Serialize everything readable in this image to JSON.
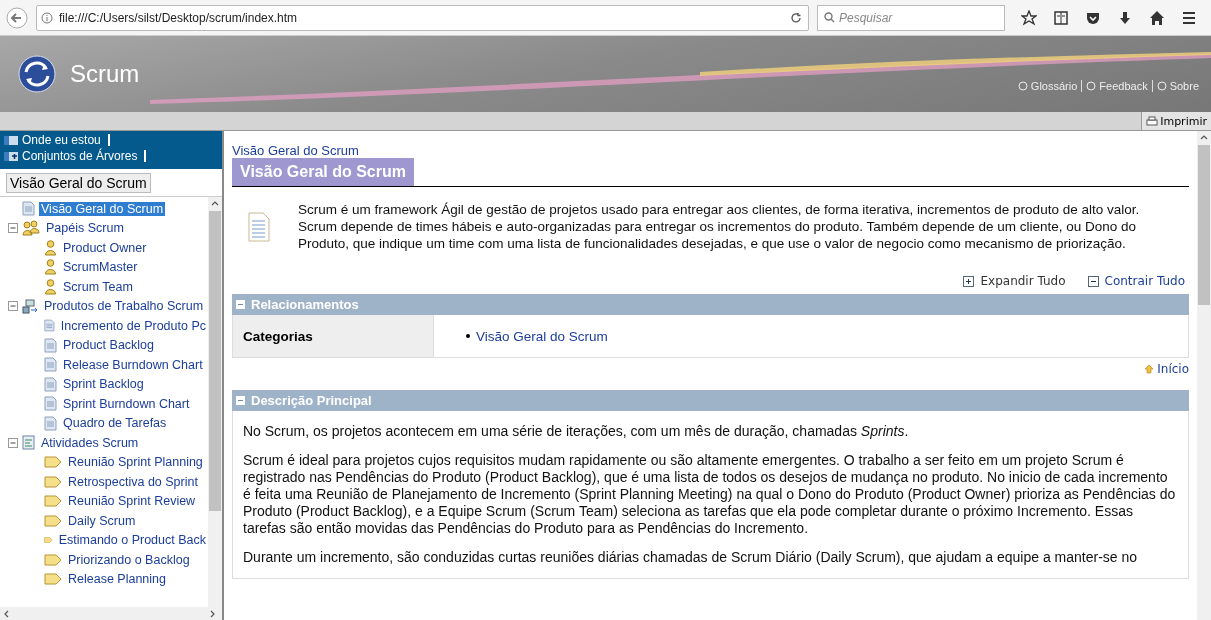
{
  "browser": {
    "url": "file:///C:/Users/silst/Desktop/scrum/index.htm",
    "search_placeholder": "Pesquisar"
  },
  "banner": {
    "title": "Scrum",
    "links": [
      "Glossário",
      "Feedback",
      "Sobre"
    ]
  },
  "print_button": "Imprimir",
  "sidebar": {
    "links": [
      "Onde eu estou",
      "Conjuntos de Árvores"
    ],
    "tab": "Visão Geral do Scrum",
    "tree": [
      {
        "label": "Visão Geral do Scrum",
        "kind": "doc",
        "selected": true
      },
      {
        "label": "Papéis Scrum",
        "kind": "roles",
        "selected": false,
        "expanded": true,
        "children": [
          {
            "label": "Product Owner",
            "kind": "role",
            "selected": false
          },
          {
            "label": "ScrumMaster",
            "kind": "role",
            "selected": false
          },
          {
            "label": "Scrum Team",
            "kind": "role",
            "selected": false
          }
        ]
      },
      {
        "label": "Produtos de Trabalho Scrum",
        "kind": "products",
        "selected": false,
        "expanded": true,
        "children": [
          {
            "label": "Incremento de Produto Pc",
            "kind": "doc",
            "selected": false
          },
          {
            "label": "Product Backlog",
            "kind": "doc",
            "selected": false
          },
          {
            "label": "Release Burndown Chart",
            "kind": "doc",
            "selected": false
          },
          {
            "label": "Sprint Backlog",
            "kind": "doc",
            "selected": false
          },
          {
            "label": "Sprint Burndown Chart",
            "kind": "doc",
            "selected": false
          },
          {
            "label": "Quadro de Tarefas",
            "kind": "doc",
            "selected": false
          }
        ]
      },
      {
        "label": "Atividades Scrum",
        "kind": "activities",
        "selected": false,
        "expanded": true,
        "children": [
          {
            "label": "Reunião Sprint Planning",
            "kind": "task",
            "selected": false
          },
          {
            "label": "Retrospectiva do Sprint",
            "kind": "task",
            "selected": false
          },
          {
            "label": "Reunião Sprint Review",
            "kind": "task",
            "selected": false
          },
          {
            "label": "Daily Scrum",
            "kind": "task",
            "selected": false
          },
          {
            "label": "Estimando o Product Back",
            "kind": "task",
            "selected": false
          },
          {
            "label": "Priorizando o Backlog",
            "kind": "task",
            "selected": false
          },
          {
            "label": "Release Planning",
            "kind": "task",
            "selected": false
          }
        ]
      }
    ]
  },
  "content": {
    "breadcrumb": "Visão Geral do Scrum",
    "title": "Visão Geral do Scrum",
    "intro": "Scrum é um framework Ágil de gestão de projetos usado para entregar aos clientes, de forma iterativa, incrementos de produto de alto valor. Scrum depende de times hábeis e auto-organizadas para entregar os incrementos do produto. Também depende de um cliente, ou Dono do Produto, que indique um time com uma lista de funcionalidades desejadas, e que use o valor de negocio como mecanismo de priorização.",
    "expand_all": "Expandir Tudo",
    "collapse_all": "Contrair Tudo",
    "relations": {
      "header": "Relacionamentos",
      "rows": [
        {
          "label": "Categorias",
          "links": [
            "Visão Geral do Scrum"
          ]
        }
      ]
    },
    "top_link": "Início",
    "description": {
      "header": "Descrição Principal",
      "paragraphs": [
        "No Scrum, os projetos acontecem em uma série de iterações, com um mês de duração, chamadas *Sprints*.",
        "Scrum é ideal para projetos cujos requisitos mudam rapidamente ou são altamente emergentes. O trabalho a ser feito em um projeto Scrum é registrado nas Pendências do Produto (Product Backlog), que é uma lista de todos os desejos de mudança no produto. No inicio de cada incremento é feita uma Reunião de Planejamento de Incremento (Sprint Planning Meeting) na qual o Dono do Produto (Product Owner) prioriza as Pendências do Produto (Product Backlog), e a Equipe Scrum (Scrum Team) seleciona as tarefas que ela pode completar durante o próximo Incremento. Essas tarefas são então movidas das Pendências do Produto para as Pendências do Incremento.",
        "Durante um incremento, são conduzidas curtas reuniões diárias chamadas de Scrum Diário (Daily Scrum), que ajudam a equipe a manter-se no"
      ]
    }
  }
}
